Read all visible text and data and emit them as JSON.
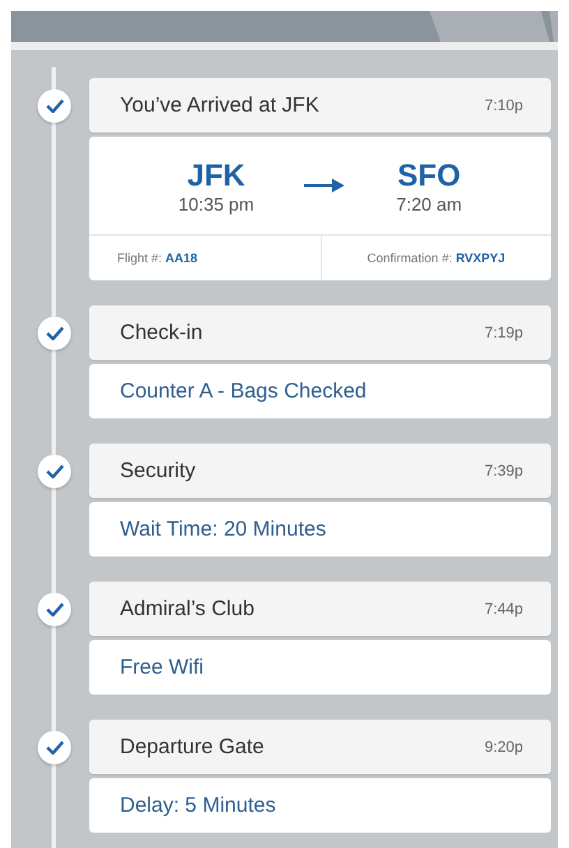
{
  "steps": [
    {
      "kind": "route",
      "completed": true,
      "title": "You’ve Arrived at JFK",
      "time": "7:10p",
      "origin": {
        "code": "JFK",
        "time": "10:35 pm"
      },
      "destination": {
        "code": "SFO",
        "time": "7:20 am"
      },
      "flight": "Flight #: **AA18**",
      "confirmation": "Confirmation #: **RVXPYJ**"
    },
    {
      "kind": "note",
      "completed": true,
      "title": "Check-in",
      "time": "7:19p",
      "note": "Counter A - Bags Checked"
    },
    {
      "kind": "note",
      "completed": true,
      "title": "Security",
      "time": "7:39p",
      "note": "Wait Time: 20 Minutes"
    },
    {
      "kind": "note",
      "completed": true,
      "title": "Admiral’s Club",
      "time": "7:44p",
      "note": "Free Wifi"
    },
    {
      "kind": "note",
      "completed": true,
      "title": "Departure Gate",
      "time": "9:20p",
      "note": "Delay: 5 Minutes"
    }
  ]
}
